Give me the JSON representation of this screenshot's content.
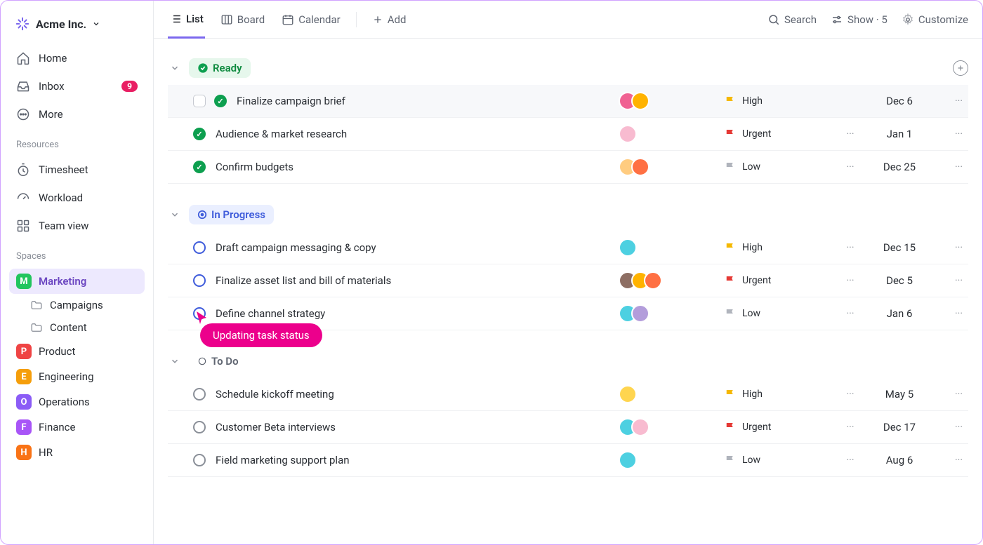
{
  "workspace": {
    "name": "Acme Inc."
  },
  "sidebar": {
    "home": "Home",
    "inbox": "Inbox",
    "inbox_count": "9",
    "more": "More",
    "section_resources": "Resources",
    "timesheet": "Timesheet",
    "workload": "Workload",
    "teamview": "Team view",
    "section_spaces": "Spaces",
    "spaces": [
      {
        "letter": "M",
        "label": "Marketing",
        "color": "#22c55e",
        "active": true
      },
      {
        "letter": "P",
        "label": "Product",
        "color": "#ef4444"
      },
      {
        "letter": "E",
        "label": "Engineering",
        "color": "#f59e0b"
      },
      {
        "letter": "O",
        "label": "Operations",
        "color": "#8b5cf6"
      },
      {
        "letter": "F",
        "label": "Finance",
        "color": "#a855f7"
      },
      {
        "letter": "H",
        "label": "HR",
        "color": "#f97316"
      }
    ],
    "marketing_children": [
      {
        "label": "Campaigns"
      },
      {
        "label": "Content"
      }
    ]
  },
  "views": {
    "list": "List",
    "board": "Board",
    "calendar": "Calendar",
    "add": "Add"
  },
  "topbar": {
    "search": "Search",
    "show": "Show · 5",
    "customize": "Customize"
  },
  "groups": [
    {
      "key": "ready",
      "label": "Ready",
      "style": "ready",
      "tasks": [
        {
          "name": "Finalize campaign brief",
          "priority": "High",
          "date": "Dec 6",
          "avatars": [
            "#f06292",
            "#ffb300"
          ],
          "hovered": true,
          "show_menu1": false
        },
        {
          "name": "Audience & market research",
          "priority": "Urgent",
          "date": "Jan 1",
          "avatars": [
            "#f8bbd0"
          ],
          "show_menu1": true
        },
        {
          "name": "Confirm budgets",
          "priority": "Low",
          "date": "Dec 25",
          "avatars": [
            "#ffcc80",
            "#ff7043"
          ],
          "show_menu1": true
        }
      ]
    },
    {
      "key": "progress",
      "label": "In Progress",
      "style": "progress",
      "tasks": [
        {
          "name": "Draft campaign messaging & copy",
          "priority": "High",
          "date": "Dec 15",
          "avatars": [
            "#4dd0e1"
          ],
          "show_menu1": true
        },
        {
          "name": "Finalize asset list and bill of materials",
          "priority": "Urgent",
          "date": "Dec 5",
          "avatars": [
            "#8d6e63",
            "#ffb300",
            "#ff7043"
          ],
          "show_menu1": true
        },
        {
          "name": "Define channel strategy",
          "priority": "Low",
          "date": "Jan 6",
          "avatars": [
            "#4dd0e1",
            "#b39ddb"
          ],
          "show_menu1": true
        }
      ]
    },
    {
      "key": "todo",
      "label": "To Do",
      "style": "todo",
      "tasks": [
        {
          "name": "Schedule kickoff meeting",
          "priority": "High",
          "date": "May 5",
          "avatars": [
            "#ffd54f"
          ],
          "show_menu1": true
        },
        {
          "name": "Customer Beta interviews",
          "priority": "Urgent",
          "date": "Dec 17",
          "avatars": [
            "#4dd0e1",
            "#f8bbd0"
          ],
          "show_menu1": true
        },
        {
          "name": "Field marketing support plan",
          "priority": "Low",
          "date": "Aug 6",
          "avatars": [
            "#4dd0e1"
          ],
          "show_menu1": true
        }
      ]
    }
  ],
  "overlay": {
    "label": "Updating task status"
  },
  "priority_labels": {
    "High": "High",
    "Urgent": "Urgent",
    "Low": "Low"
  }
}
